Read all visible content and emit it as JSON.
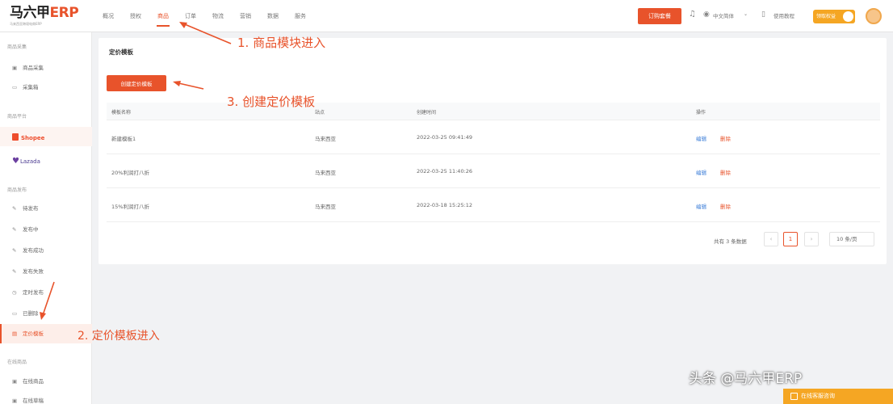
{
  "logo": {
    "brand": "马六甲",
    "erp": "ERP",
    "sub": "马来西亚跨境电商ERP"
  },
  "nav": {
    "items": [
      "概况",
      "授权",
      "商品",
      "订单",
      "物流",
      "营销",
      "数据",
      "服务"
    ],
    "active": "商品"
  },
  "header": {
    "order_label": "订购套餐",
    "lang_label": "中文简体",
    "guide_label": "使用教程",
    "vip_label": "领取权益"
  },
  "sidebar": {
    "group_collect": "商品采集",
    "collect_items": [
      "商品采集",
      "采集箱"
    ],
    "group_platform": "商品平台",
    "platforms": [
      "Shopee",
      "Lazada"
    ],
    "group_publish": "商品发布",
    "publish_items": [
      "待发布",
      "发布中",
      "发布成功",
      "发布失败",
      "定时发布",
      "已删除",
      "定价模板"
    ],
    "active_item": "定价模板",
    "group_online": "在线商品",
    "online_items": [
      "在线商品",
      "在线草稿"
    ]
  },
  "main": {
    "title": "定价模板",
    "create_label": "创建定价模板",
    "columns": [
      "模板名称",
      "站点",
      "创建时间",
      "操作"
    ],
    "rows": [
      {
        "name": "新建模板1",
        "site": "马来西亚",
        "created": "2022-03-25 09:41:49",
        "edit": "编辑",
        "delete": "删除"
      },
      {
        "name": "20%利润打八折",
        "site": "马来西亚",
        "created": "2022-03-25 11:40:26",
        "edit": "编辑",
        "delete": "删除"
      },
      {
        "name": "15%利润打八折",
        "site": "马来西亚",
        "created": "2022-03-18 15:25:12",
        "edit": "编辑",
        "delete": "删除"
      }
    ],
    "pagination": {
      "total_text": "共有 3 条数据",
      "prev": "‹",
      "current": "1",
      "next": "›",
      "page_size": "10 条/页"
    }
  },
  "annotations": {
    "step1": "1. 商品模块进入",
    "step2": "2. 定价模板进入",
    "step3": "3. 创建定价模板"
  },
  "watermark": "头条 @马六甲ERP",
  "float_button": "在线客服咨询",
  "colors": {
    "accent": "#e8532b",
    "annotation": "#e8532b",
    "gold": "#f5a623",
    "link": "#3e7fd8"
  },
  "icons": [
    "bell-icon",
    "globe-icon",
    "book-icon",
    "chevron-down-icon"
  ]
}
